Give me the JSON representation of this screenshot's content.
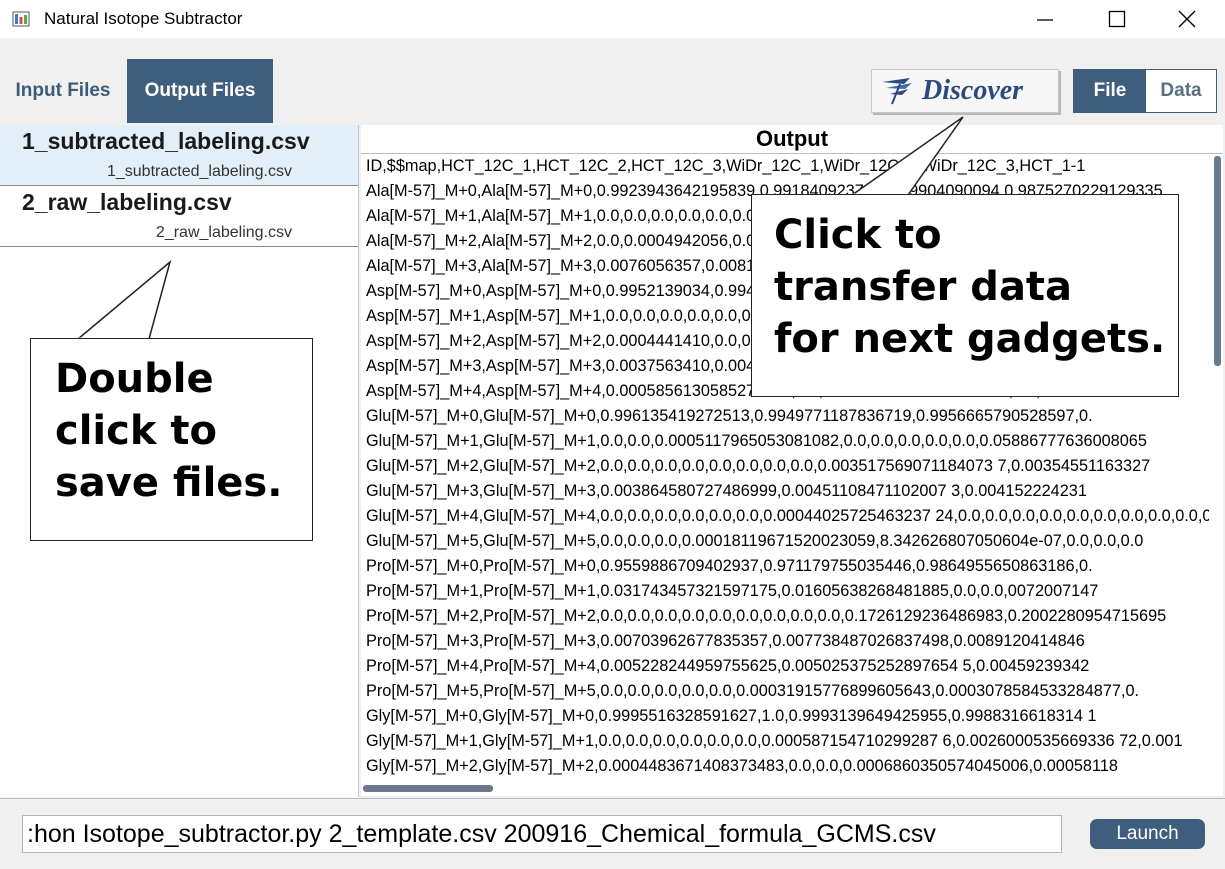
{
  "window": {
    "title": "Natural Isotope Subtractor"
  },
  "tabs": [
    {
      "label": "Input Files"
    },
    {
      "label": "Output Files"
    }
  ],
  "discover_label": "Discover",
  "segmented": {
    "file": "File",
    "data": "Data"
  },
  "files": [
    {
      "name": "1_subtracted_labeling.csv",
      "sub": "1_subtracted_labeling.csv"
    },
    {
      "name": "2_raw_labeling.csv",
      "sub": "2_raw_labeling.csv"
    }
  ],
  "output": {
    "title": "Output",
    "lines": [
      "ID,$$map,HCT_12C_1,HCT_12C_2,HCT_12C_3,WiDr_12C_1,WiDr_12C_2,WiDr_12C_3,HCT_1-1",
      "Ala[M-57]_M+0,Ala[M-57]_M+0,0.9923943642195839,0.9918409237924,0.9904090094,0.9875270229129335,",
      "Ala[M-57]_M+1,Ala[M-57]_M+1,0.0,0.0,0.0,0.0,0.0,0.0,0.0,0.0,0.0,0.0,0.0,0.0,0.0,0.00097321042,0",
      "Ala[M-57]_M+2,Ala[M-57]_M+2,0.0,0.0004942056,0.0003941,0.0,0.0,0.0,0.0,0.0,0.0,0.0,0.000834790",
      "Ala[M-57]_M+3,Ala[M-57]_M+3,0.0076056357,0.0081590762,0.0095909906,0.0124729771,0.0124729478",
      "Asp[M-57]_M+0,Asp[M-57]_M+0,0.9952139034,0.9948130000,0.9952640000,0.9939068000,0.9943968",
      "Asp[M-57]_M+1,Asp[M-57]_M+1,0.0,0.0,0.0,0.0,0.0,0.0,0.0,0.0,0.0,0.0,0.0,0.0,0.0,0.0,0.0,0.0,0.0,0",
      "Asp[M-57]_M+2,Asp[M-57]_M+2,0.0004441410,0.0,0.0,0.0,0.0,0.0,0.0,0.0,0.0,0.0,0.0,0.0,0.0,0.0,0.0,0",
      "Asp[M-57]_M+3,Asp[M-57]_M+3,0.0037563410,0.0040215000,0.0038120000,0.0046190000,0.0041505",
      "Asp[M-57]_M+4,Asp[M-57]_M+4,0.0005856130585274743,0.0,0.0016738877305770261,0.0,0.0014451",
      "Glu[M-57]_M+0,Glu[M-57]_M+0,0.996135419272513,0.9949771187836719,0.9956665790528597,0.",
      "Glu[M-57]_M+1,Glu[M-57]_M+1,0.0,0.0,0.0005117965053081082,0.0,0.0,0.0,0.0,0.0,0.05886777636008065",
      "Glu[M-57]_M+2,Glu[M-57]_M+2,0.0,0.0,0.0,0.0,0.0,0.0,0.0,0.0,0.003517569071184073 7,0.00354551163327",
      "Glu[M-57]_M+3,Glu[M-57]_M+3,0.003864580727486999,0.00451108471102007 3,0.004152224231",
      "Glu[M-57]_M+4,Glu[M-57]_M+4,0.0,0.0,0.0,0.0,0.0,0.0,0.00044025725463237 24,0.0,0.0,0.0,0.0,0.0,0.0,0.0,0.0,0.0,0",
      "Glu[M-57]_M+5,Glu[M-57]_M+5,0.0,0.0,0.0,0.00018119671520023059,8.342626807050604e-07,0.0,0.0,0.0",
      "Pro[M-57]_M+0,Pro[M-57]_M+0,0.9559886709402937,0.971179755035446,0.9864955650863186,0.",
      "Pro[M-57]_M+1,Pro[M-57]_M+1,0.031743457321597175,0.01605638268481885,0.0,0.0,0072007147",
      "Pro[M-57]_M+2,Pro[M-57]_M+2,0.0,0.0,0.0,0.0,0.0,0.0,0.0,0.0,0.0,0.1726129236486983,0.2002280954715695",
      "Pro[M-57]_M+3,Pro[M-57]_M+3,0.00703962677835357,0.007738487026837498,0.0089120414846",
      "Pro[M-57]_M+4,Pro[M-57]_M+4,0.005228244959755625,0.005025375252897654 5,0.00459239342",
      "Pro[M-57]_M+5,Pro[M-57]_M+5,0.0,0.0,0.0,0.0,0.0,0.00031915776899605643,0.0003078584533284877,0.",
      "Gly[M-57]_M+0,Gly[M-57]_M+0,0.9995516328591627,1.0,0.9993139649425955,0.9988316618314 1",
      "Gly[M-57]_M+1,Gly[M-57]_M+1,0.0,0.0,0.0,0.0,0.0,0.0,0.000587154710299287 6,0.0026000535669336 72,0.001",
      "Gly[M-57]_M+2,Gly[M-57]_M+2,0.0004483671408373483,0.0,0.0,0.0006860350574045006,0.00058118"
    ]
  },
  "command": {
    "value": ":hon Isotope_subtractor.py 2_template.csv 200916_Chemical_formula_GCMS.csv",
    "launch_label": "Launch"
  },
  "callouts": {
    "left": [
      "Double",
      "click to",
      "save files."
    ],
    "right": [
      "Click to",
      "transfer data",
      "for next gadgets."
    ]
  },
  "colors": {
    "accent": "#3f5d7d",
    "selected_file_bg": "#e2eef8",
    "discover_text": "#2b4a7e"
  }
}
